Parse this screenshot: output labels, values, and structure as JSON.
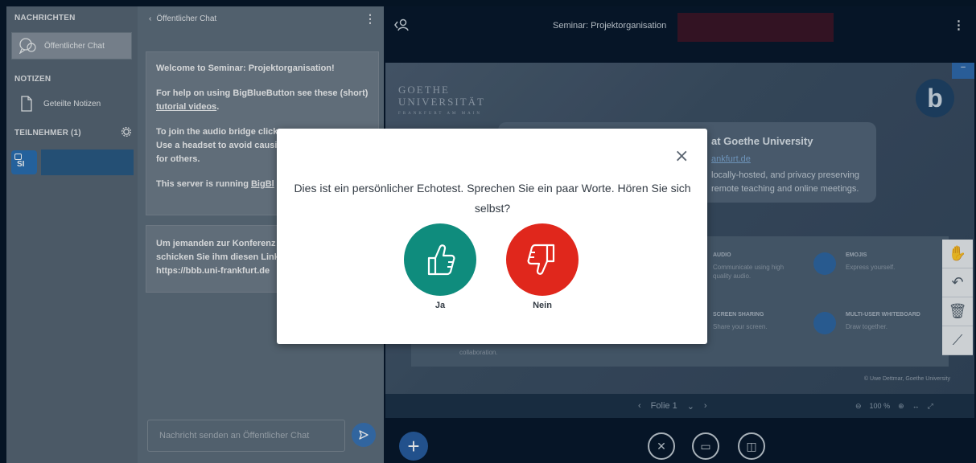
{
  "sidebar": {
    "messages_title": "NACHRICHTEN",
    "public_chat": "Öffentlicher Chat",
    "notes_title": "NOTIZEN",
    "shared_notes": "Geteilte Notizen",
    "participants_title": "TEILNEHMER (1)",
    "user_initials": "SI"
  },
  "chat": {
    "title": "Öffentlicher Chat",
    "welcome_title": "Welcome to Seminar: Projektorganisation!",
    "help_prefix": "For help on using BigBlueButton see these (short) ",
    "help_link": "tutorial videos",
    "help_suffix": ".",
    "audio_line1": "To join the audio bridge click",
    "audio_line2": "Use a headset to avoid causi",
    "audio_line3": "for others.",
    "server_prefix": "This server is running ",
    "server_link": "BigBl",
    "invite_line1": "Um jemanden zur Konferenz",
    "invite_line2": "schicken Sie ihm diesen Link",
    "invite_line3": "https://bbb.uni-frankfurt.de",
    "input_placeholder": "Nachricht senden an Öffentlicher Chat"
  },
  "main": {
    "title": "Seminar: Projektorganisation"
  },
  "slide": {
    "uni_line1": "GOETHE",
    "uni_line2": "UNIVERSITÄT",
    "uni_line3": "FRANKFURT AM MAIN",
    "logo": "b",
    "minimize": "–",
    "heading": "at Goethe University",
    "link": "ankfurt.de",
    "desc_line1": "locally-hosted, and privacy preserving",
    "desc_line2": "remote teaching and online meetings.",
    "features": [
      {
        "title": "AUDIO",
        "desc1": "Communicate using high",
        "desc2": "quality audio."
      },
      {
        "title": "EMOJIS",
        "desc1": "Express yourself.",
        "desc2": ""
      },
      {
        "title": "SCREEN SHARING",
        "desc1": "Share your screen.",
        "desc2": ""
      },
      {
        "title": "MULTI-USER WHITEBOARD",
        "desc1": "Draw together.",
        "desc2": ""
      }
    ],
    "collab": "collaboration.",
    "copyright": "© Uwe Dettmar, Goethe University"
  },
  "nav": {
    "slide_label": "Folie 1",
    "zoom": "100 %"
  },
  "modal": {
    "message": "Dies ist ein persönlicher Echotest. Sprechen Sie ein paar Worte. Hören Sie sich selbst?",
    "yes_label": "Ja",
    "no_label": "Nein",
    "close": "×"
  },
  "colors": {
    "yes_button": "#0f8c7d",
    "no_button": "#e0271c",
    "accent": "#275da0"
  }
}
